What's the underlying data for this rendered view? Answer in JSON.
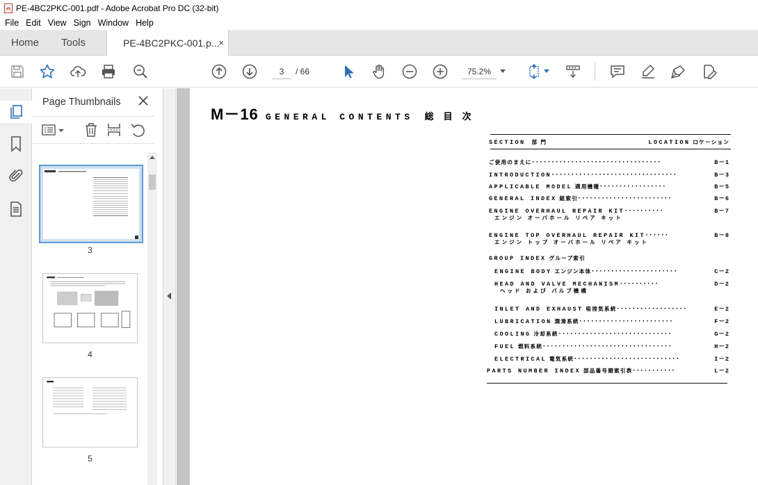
{
  "window": {
    "title": "PE-4BC2PKC-001.pdf - Adobe Acrobat Pro DC (32-bit)"
  },
  "menu": [
    "File",
    "Edit",
    "View",
    "Sign",
    "Window",
    "Help"
  ],
  "tabs": {
    "home": "Home",
    "tools": "Tools",
    "document": "PE-4BC2PKC-001.p...",
    "close": "×"
  },
  "toolbar": {
    "page_current": "3",
    "page_of": "/ 66",
    "zoom": "75.2%"
  },
  "thumbnails": {
    "title": "Page Thumbnails",
    "pages": [
      {
        "label": "3",
        "selected": true
      },
      {
        "label": "4",
        "selected": false
      },
      {
        "label": "5",
        "selected": false
      }
    ]
  },
  "document": {
    "heading": {
      "mnum": "M－16",
      "title": "GENERAL CONTENTS",
      "title_jp": "総目次"
    },
    "toc_header": {
      "section": "SECTION",
      "section_jp": "部 門",
      "location": "LOCATION",
      "location_jp": "ロケーション"
    },
    "entries": [
      {
        "jp": "ご使用のまえに",
        "en": "",
        "loc": "B－1"
      },
      {
        "jp": "",
        "en": "INTRODUCTION",
        "loc": "B－3"
      },
      {
        "jp": "適用機種",
        "en": "APPLICABLE MODEL",
        "loc": "B－5"
      },
      {
        "jp": "総索引",
        "en": "GENERAL INDEX",
        "loc": "B－6"
      },
      {
        "jp": "",
        "en": "ENGINE OVERHAUL REPAIR KIT",
        "loc": "B－7",
        "sub": "エンジン オーバホール リペア キット"
      },
      {
        "jp": "",
        "en": "ENGINE TOP OVERHAUL REPAIR KIT",
        "loc": "B－8",
        "sub": "エンジン トップ オーバホール リペア キット"
      },
      {
        "jp": "グループ索引",
        "en": "GROUP INDEX",
        "loc": ""
      },
      {
        "jp": "エンジン本体",
        "en": "ENGINE BODY",
        "loc": "C－2"
      },
      {
        "jp": "",
        "en": "HEAD AND VALVE MECHANISM",
        "loc": "D－2",
        "sub": "ヘッド および バルブ機構"
      },
      {
        "jp": "吸排気系統",
        "en": "INLET AND EXHAUST",
        "loc": "E－2"
      },
      {
        "jp": "潤滑系統",
        "en": "LUBRICATION",
        "loc": "F－2"
      },
      {
        "jp": "冷却系統",
        "en": "COOLING",
        "loc": "G－2"
      },
      {
        "jp": "燃料系統",
        "en": "FUEL",
        "loc": "H－2"
      },
      {
        "jp": "電気系統",
        "en": "ELECTRICAL",
        "loc": "I－2"
      },
      {
        "jp": "部品番号順索引表",
        "en": "PARTS NUMBER INDEX",
        "loc": "L－2"
      }
    ]
  }
}
